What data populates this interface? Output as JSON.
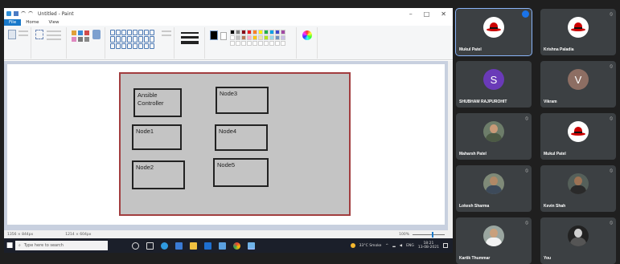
{
  "paint": {
    "window_title": "Untitled - Paint",
    "tabs": [
      "File",
      "Home",
      "View"
    ],
    "status": {
      "size": "1356 × 844px",
      "selection": "1214 × 604px",
      "zoom": "100%"
    }
  },
  "diagram": {
    "nodes": [
      {
        "label": "Ansible\nController"
      },
      {
        "label": "Node3"
      },
      {
        "label": "Node1"
      },
      {
        "label": "Node4"
      },
      {
        "label": "Node2"
      },
      {
        "label": "Node5"
      }
    ]
  },
  "taskbar": {
    "search_placeholder": "Type here to search",
    "weather": "33°C Smoke",
    "lang": "ENG",
    "time": "18:21",
    "date": "13-08-2021"
  },
  "meet": {
    "participants": [
      {
        "name": "Mukul Patel",
        "avatar": "redhat-logo",
        "active": true
      },
      {
        "name": "Krishna Paladia",
        "avatar": "redhat-logo"
      },
      {
        "name": "SHUBHAM RAJPUROHIT",
        "avatar": "letter",
        "letter": "S",
        "color": "#6a3ab8"
      },
      {
        "name": "Vikram",
        "avatar": "letter",
        "letter": "V",
        "color": "#8d6e63"
      },
      {
        "name": "Maharsh Patel",
        "avatar": "photo"
      },
      {
        "name": "Mukul Patel",
        "avatar": "redhat-logo"
      },
      {
        "name": "Lokesh Sharma",
        "avatar": "photo"
      },
      {
        "name": "Kevin Shah",
        "avatar": "photo"
      },
      {
        "name": "Kartik Thummar",
        "avatar": "photo"
      },
      {
        "name": "You",
        "avatar": "photo"
      }
    ]
  },
  "colors": {
    "accent": "#1979ca",
    "diagram_border": "#a23d3f",
    "meet_tile": "#3c4043",
    "active_outline": "#8ab4f8"
  }
}
